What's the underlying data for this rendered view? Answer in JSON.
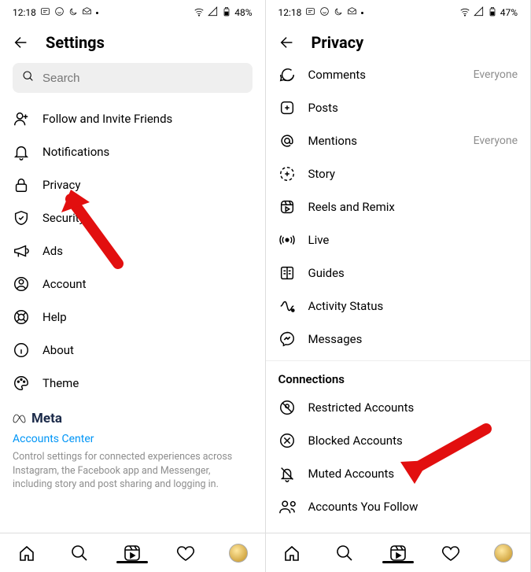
{
  "left": {
    "status": {
      "time": "12:18",
      "battery": "48%"
    },
    "header": {
      "title": "Settings"
    },
    "search": {
      "placeholder": "Search"
    },
    "items": [
      {
        "label": "Follow and Invite Friends"
      },
      {
        "label": "Notifications"
      },
      {
        "label": "Privacy"
      },
      {
        "label": "Security"
      },
      {
        "label": "Ads"
      },
      {
        "label": "Account"
      },
      {
        "label": "Help"
      },
      {
        "label": "About"
      },
      {
        "label": "Theme"
      }
    ],
    "meta": {
      "brand": "Meta",
      "link": "Accounts Center",
      "desc": "Control settings for connected experiences across Instagram, the Facebook app and Messenger, including story and post sharing and logging in."
    }
  },
  "right": {
    "status": {
      "time": "12:18",
      "battery": "47%"
    },
    "header": {
      "title": "Privacy"
    },
    "items": [
      {
        "label": "Comments",
        "trail": "Everyone"
      },
      {
        "label": "Posts"
      },
      {
        "label": "Mentions",
        "trail": "Everyone"
      },
      {
        "label": "Story"
      },
      {
        "label": "Reels and Remix"
      },
      {
        "label": "Live"
      },
      {
        "label": "Guides"
      },
      {
        "label": "Activity Status"
      },
      {
        "label": "Messages"
      }
    ],
    "section": "Connections",
    "connections": [
      {
        "label": "Restricted Accounts"
      },
      {
        "label": "Blocked Accounts"
      },
      {
        "label": "Muted Accounts"
      },
      {
        "label": "Accounts You Follow"
      }
    ]
  }
}
